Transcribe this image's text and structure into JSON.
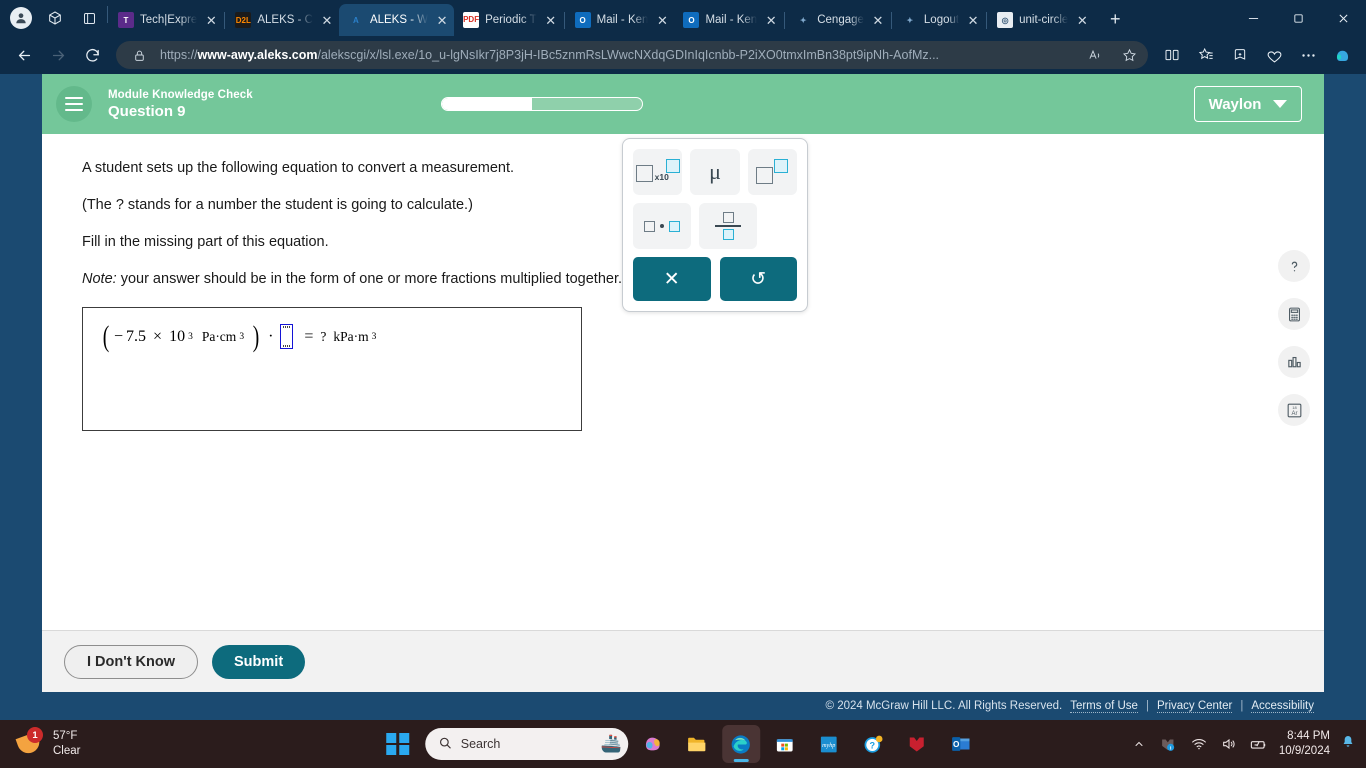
{
  "browser": {
    "tabs": [
      {
        "title": "Tech|Expre",
        "favicon": "temple-university-icon",
        "active": false
      },
      {
        "title": "ALEKS - C",
        "favicon": "d2l-icon",
        "active": false
      },
      {
        "title": "ALEKS - W",
        "favicon": "aleks-icon",
        "active": true
      },
      {
        "title": "Periodic T",
        "favicon": "pdf-icon",
        "active": false
      },
      {
        "title": "Mail - Ken",
        "favicon": "outlook-icon",
        "active": false
      },
      {
        "title": "Mail - Ken",
        "favicon": "outlook-icon",
        "active": false
      },
      {
        "title": "Cengage",
        "favicon": "loading-spinner-icon",
        "active": false
      },
      {
        "title": "Logout",
        "favicon": "loading-spinner-icon",
        "active": false
      },
      {
        "title": "unit-circle",
        "favicon": "unit-circle-icon",
        "active": false
      }
    ],
    "new_tab_label": "+",
    "window_controls": {
      "minimize": "─",
      "maximize": "❐",
      "close": "✕"
    },
    "url": {
      "scheme": "https://",
      "domain": "www-awy.aleks.com",
      "path": "/alekscgi/x/lsl.exe/1o_u-lgNsIkr7j8P3jH-IBc5znmRsLWwcNXdqGDInIqIcnbb-P2iXO0tmxImBn38pt9ipNh-AofMz..."
    },
    "toolbar_icons": [
      "back-icon",
      "refresh-icon",
      "lock-icon",
      "read-aloud-icon",
      "favorite-star-icon",
      "split-screen-icon",
      "favorites-icon",
      "collections-icon",
      "browser-essentials-icon",
      "settings-more-icon",
      "copilot-icon"
    ]
  },
  "aleks": {
    "header": {
      "menu_icon": "hamburger-menu-icon",
      "subtitle": "Module Knowledge Check",
      "title": "Question 9",
      "progress_percent": 45,
      "user_name": "Waylon"
    },
    "question": {
      "line1": "A student sets up the following equation to convert a measurement.",
      "line2": "(The ? stands for a number the student is going to calculate.)",
      "line3": "Fill in the missing part of this equation.",
      "note_label": "Note:",
      "note_text": " your answer should be in the form of one or more fractions multiplied together."
    },
    "equation": {
      "open_paren": "(",
      "sign": "−",
      "coefficient": "7.5",
      "times": "×",
      "base": "10",
      "exponent": "3",
      "units_left": "Pa·cm",
      "units_left_exp": "3",
      "close_paren": ")",
      "dot": "·",
      "answer_value": "",
      "equals": "=",
      "question_mark": "?",
      "units_right": "kPa·m",
      "units_right_exp": "3"
    },
    "keypad": {
      "keys": [
        {
          "name": "scientific-notation-key",
          "label": "□x10□"
        },
        {
          "name": "micro-prefix-key",
          "label": "μ"
        },
        {
          "name": "exponent-key",
          "label": "□^□"
        },
        {
          "name": "multiply-dot-key",
          "label": "□·□"
        },
        {
          "name": "fraction-key",
          "label": "□/□"
        }
      ],
      "x10_label": "x10",
      "mu_label": "μ",
      "clear_label": "✕",
      "undo_label": "↺"
    },
    "rail": [
      {
        "name": "help-icon",
        "glyph": "?"
      },
      {
        "name": "calculator-icon",
        "glyph": "calculator"
      },
      {
        "name": "chart-icon",
        "glyph": "bar-chart"
      },
      {
        "name": "periodic-table-icon",
        "glyph": "Ar"
      }
    ],
    "buttons": {
      "dont_know": "I Don't Know",
      "submit": "Submit"
    },
    "footer": {
      "copyright": "© 2024 McGraw Hill LLC. All Rights Reserved.",
      "links": [
        "Terms of Use",
        "Privacy Center",
        "Accessibility"
      ],
      "separator": "|"
    }
  },
  "taskbar": {
    "weather": {
      "temperature": "57°F",
      "condition": "Clear",
      "badge": "1",
      "icon": "moon-icon"
    },
    "start_label": "start-icon",
    "search_placeholder": "Search",
    "search_icon": "search-icon",
    "apps": [
      {
        "name": "copilot-icon"
      },
      {
        "name": "file-explorer-icon"
      },
      {
        "name": "edge-icon",
        "active": true
      },
      {
        "name": "microsoft-store-icon"
      },
      {
        "name": "myhp-icon"
      },
      {
        "name": "get-help-icon"
      },
      {
        "name": "mcafee-icon"
      },
      {
        "name": "outlook-icon"
      }
    ],
    "tray": {
      "chevron": "˄",
      "icons": [
        "mcafee-tray-icon",
        "wifi-icon",
        "volume-icon",
        "battery-icon"
      ],
      "time": "8:44 PM",
      "date": "10/9/2024",
      "notification_icon": "bell-icon"
    }
  },
  "colors": {
    "aleks_green": "#74c79a",
    "aleks_teal": "#0d6b7d",
    "browser_blue": "#0d2b47",
    "taskbar": "#2b1c1c"
  }
}
